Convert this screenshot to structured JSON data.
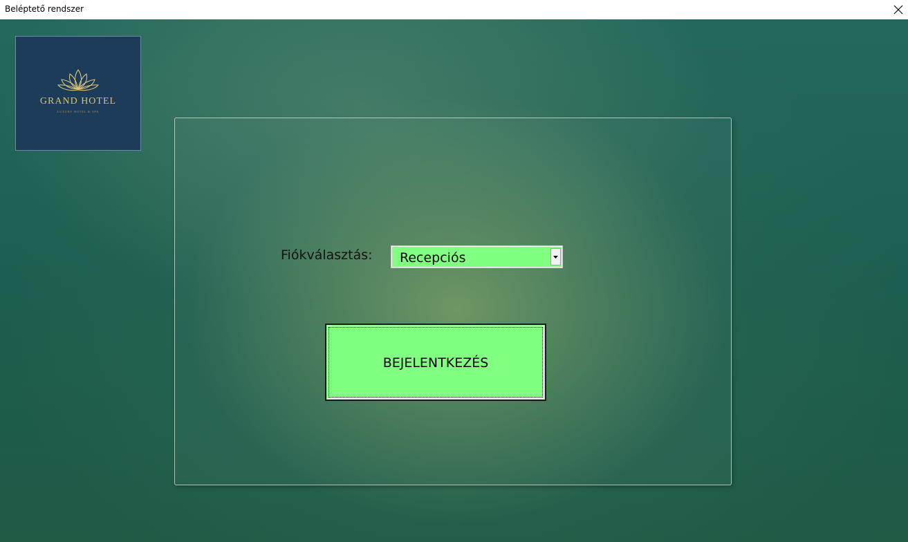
{
  "window": {
    "title": "Beléptető rendszer"
  },
  "logo": {
    "name": "GRAND HOTEL",
    "tagline": "LUXURY HOTEL & SPA",
    "icon": "lotus-icon"
  },
  "form": {
    "account_label": "Fiókválasztás:",
    "account_value": "Recepciós",
    "login_label": "BEJELENTKEZÉS"
  },
  "colors": {
    "accent_green": "#80ff80",
    "logo_bg": "#1c3c59",
    "logo_gold": "#d7c27a"
  }
}
